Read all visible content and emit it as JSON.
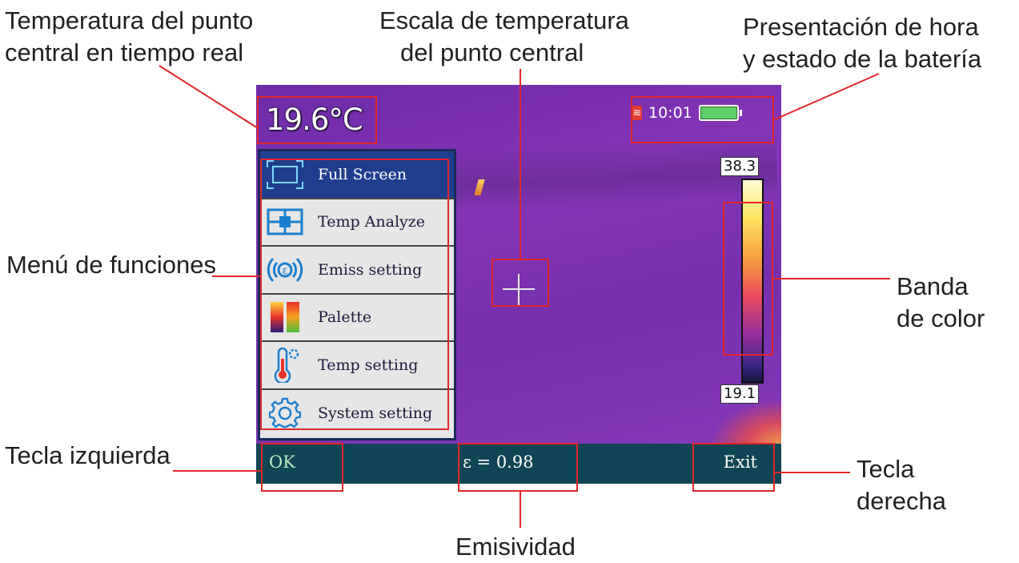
{
  "annotations": {
    "center_temp": [
      "Temperatura del punto",
      "central en tiempo real"
    ],
    "temp_scale": [
      "Escala de temperatura",
      "del punto central"
    ],
    "time_battery": [
      "Presentación de hora",
      "y estado de la batería"
    ],
    "function_menu": "Menú de funciones",
    "color_band": [
      "Banda",
      "de color"
    ],
    "left_key": "Tecla izquierda",
    "right_key": [
      "Tecla",
      "derecha"
    ],
    "emissivity": "Emisividad"
  },
  "screen": {
    "center_temperature": "19.6°C",
    "time": "10:01",
    "sd_icon": "sd-card-icon",
    "battery_level": 1.0,
    "menu": [
      {
        "label": "Full Screen",
        "icon": "full-screen-icon",
        "selected": true
      },
      {
        "label": "Temp Analyze",
        "icon": "temp-analyze-icon",
        "selected": false
      },
      {
        "label": "Emiss setting",
        "icon": "emissivity-icon",
        "selected": false
      },
      {
        "label": "Palette",
        "icon": "palette-icon",
        "selected": false
      },
      {
        "label": "Temp setting",
        "icon": "thermometer-icon",
        "selected": false
      },
      {
        "label": "System setting",
        "icon": "gear-icon",
        "selected": false
      }
    ],
    "scale_max": "38.3",
    "scale_min": "19.1",
    "bottom_bar": {
      "left_key": "OK",
      "emissivity": "ε = 0.98",
      "right_key": "Exit"
    }
  },
  "colors": {
    "highlight": "#e0262a",
    "bottom_bar": "#0f4554",
    "menu_selected": "#1f3f8e"
  }
}
